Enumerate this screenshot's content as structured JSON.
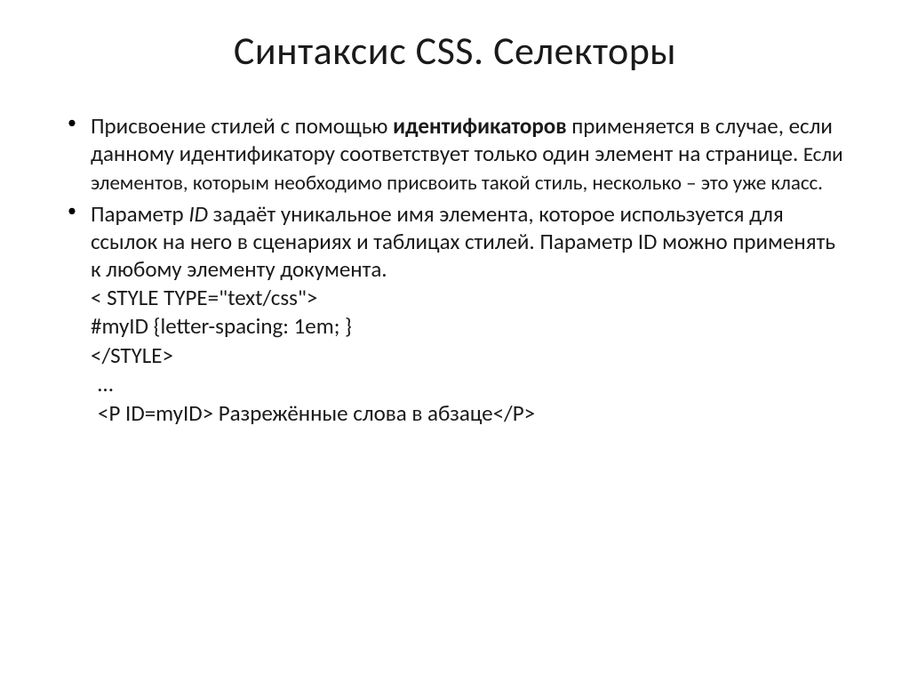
{
  "title": "Синтаксис CSS. Селекторы",
  "bullets": [
    {
      "part1": "Присвоение стилей с помощью ",
      "bold": "идентификаторов",
      "part2": " применяется в случае, если данному идентификатору соответствует только один элемент на странице. ",
      "small": "Если элементов, которым необходимо присвоить такой стиль, несколько – это уже класс."
    },
    {
      "part1": "Параметр ",
      "italic": "ID",
      "part2": " задаёт уникальное имя элемента, которое используется для ссылок на него в сценариях и таблицах стилей. Параметр ID можно применять к любому элементу документа.",
      "code1": "< STYLE TYPE=\"text/css\">",
      "code2": " #myID {letter-spacing: 1em; }",
      "code3": "</STYLE>",
      "code4": "…",
      "code5": "<P ID=myID> Разрежённые слова в абзаце</P>"
    }
  ]
}
